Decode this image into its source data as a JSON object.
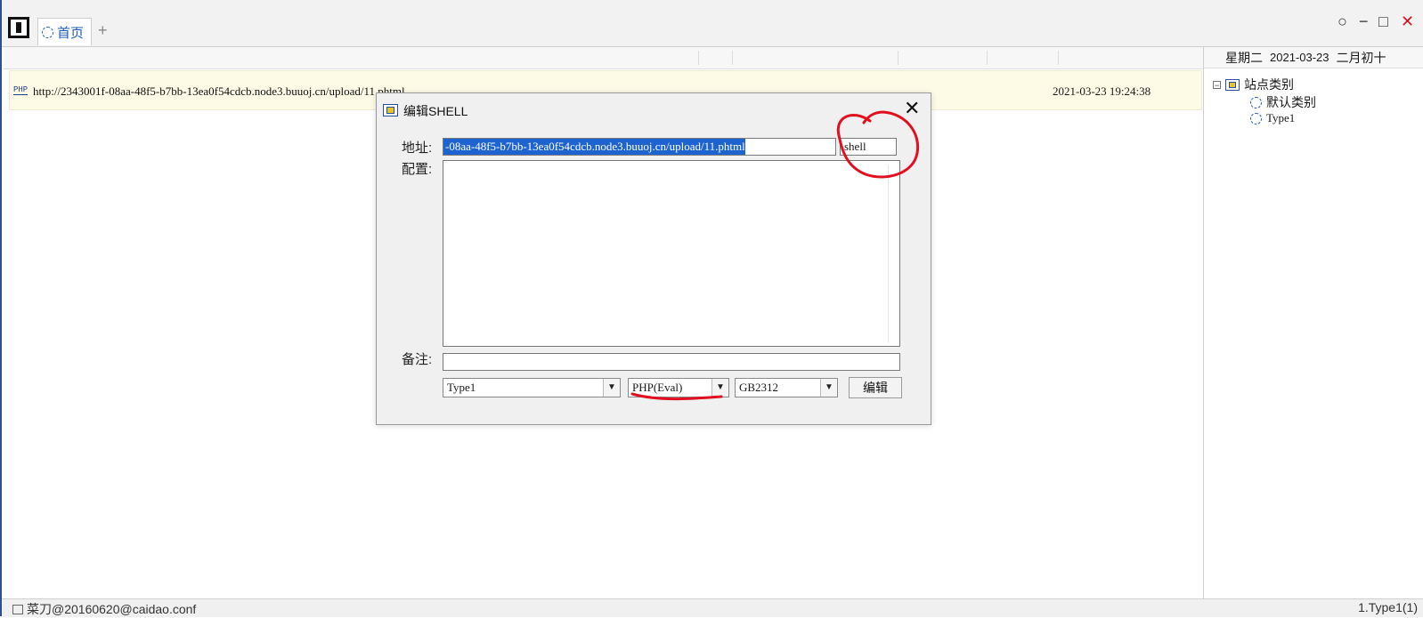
{
  "tabs": {
    "home_label": "首页",
    "add_label": "+"
  },
  "window_controls": {
    "circle": "○",
    "minimize": "−",
    "maximize": "□",
    "close": "✕"
  },
  "calendar": {
    "weekday": "星期二",
    "date": "2021-03-23",
    "lunar": "二月初十"
  },
  "tree": {
    "root_label": "站点类别",
    "root_toggle": "⊟",
    "children": [
      {
        "label": "默认类别"
      },
      {
        "label": "Type1"
      }
    ]
  },
  "row": {
    "type_badge": "PHP",
    "url": "http://2343001f-08aa-48f5-b7bb-13ea0f54cdcb.node3.buuoj.cn/upload/11.phtml",
    "ip": "",
    "time": "2021-03-23 19:24:38"
  },
  "dialog": {
    "title": "编辑SHELL",
    "close_glyph": "✕",
    "address_label": "地址:",
    "address_value": "-08aa-48f5-b7bb-13ea0f54cdcb.node3.buuoj.cn/upload/11.phtml",
    "password_value": "shell",
    "config_label": "配置:",
    "note_label": "备注:",
    "category_value": "Type1",
    "script_type_value": "PHP(Eval)",
    "encoding_value": "GB2312",
    "edit_button": "编辑"
  },
  "status": {
    "left_text": "菜刀@20160620@caidao.conf",
    "right_text": "1.Type1(1)"
  },
  "colors": {
    "selection": "#1e64d0",
    "row_highlight": "#fdfbe6",
    "annotation": "#e01020"
  }
}
